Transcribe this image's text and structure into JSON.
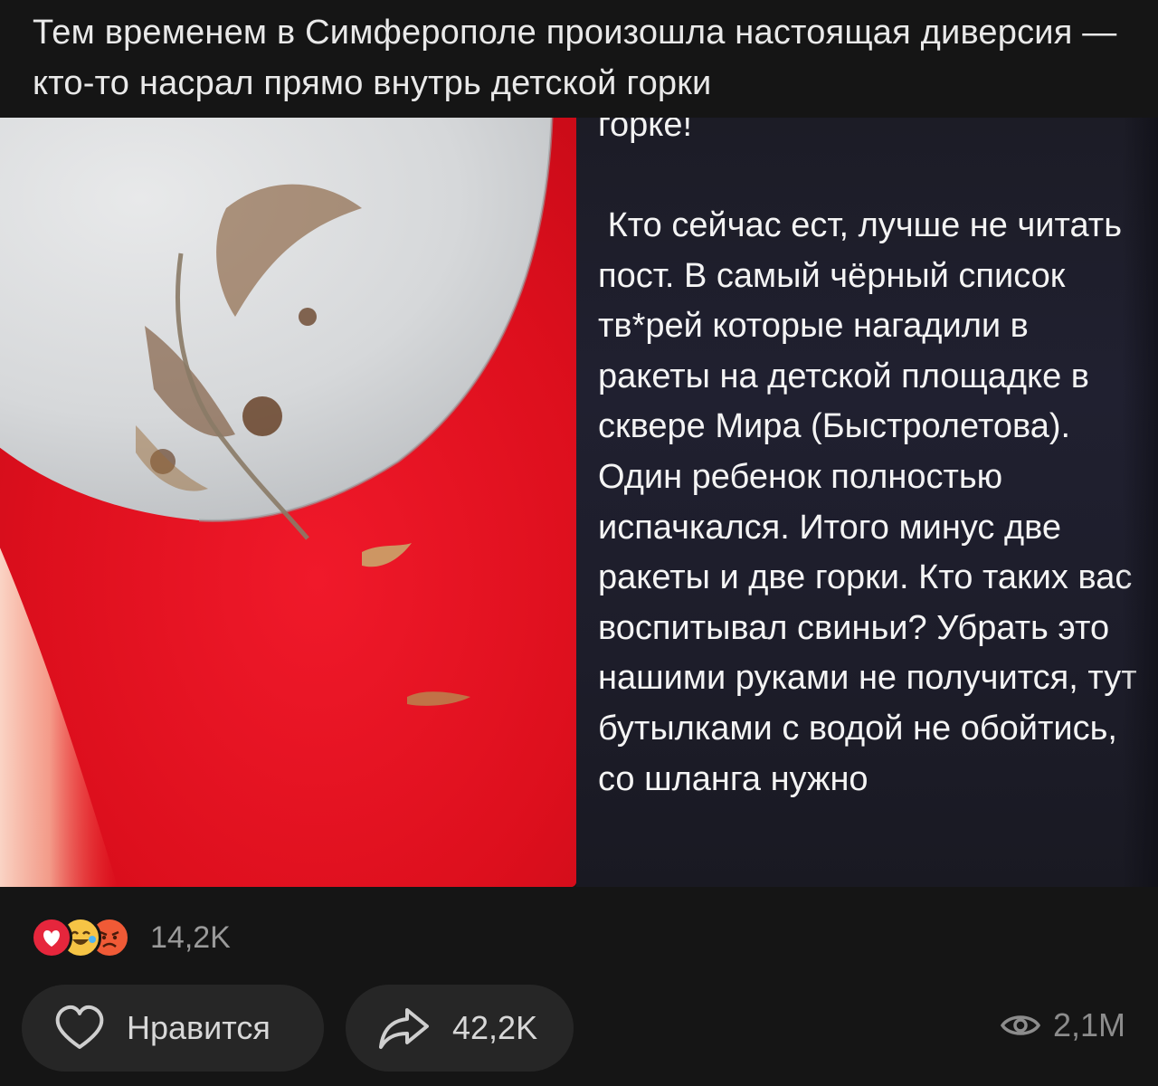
{
  "post": {
    "text": "Тем временем в Симферополе произошла настоящая диверсия — кто-то насрал прямо внутрь детской горки"
  },
  "screenshot": {
    "head": "горке!",
    "body": " Кто сейчас ест, лучше не читать пост. В самый чёрный список тв*рей которые нагадили в ракеты на детской площадке в сквере Мира (Быстролетова). Один ребенок полностью испачкался. Итого минус две ракеты и две горки. Кто таких вас воспитывал свиньи? Убрать это нашими руками не получится, тут бутылками с водой не обойтись, со шланга нужно"
  },
  "reactions": {
    "icons": [
      "heart-reaction-icon",
      "laughing-crying-reaction-icon",
      "angry-reaction-icon"
    ],
    "count": "14,2K"
  },
  "actions": {
    "like_label": "Нравится",
    "share_count": "42,2K"
  },
  "views": {
    "icon": "eye-icon",
    "count": "2,1M"
  },
  "colors": {
    "background": "#151515",
    "button": "#262626",
    "heart": "#e6263c",
    "photo_red": "#e4101e"
  }
}
